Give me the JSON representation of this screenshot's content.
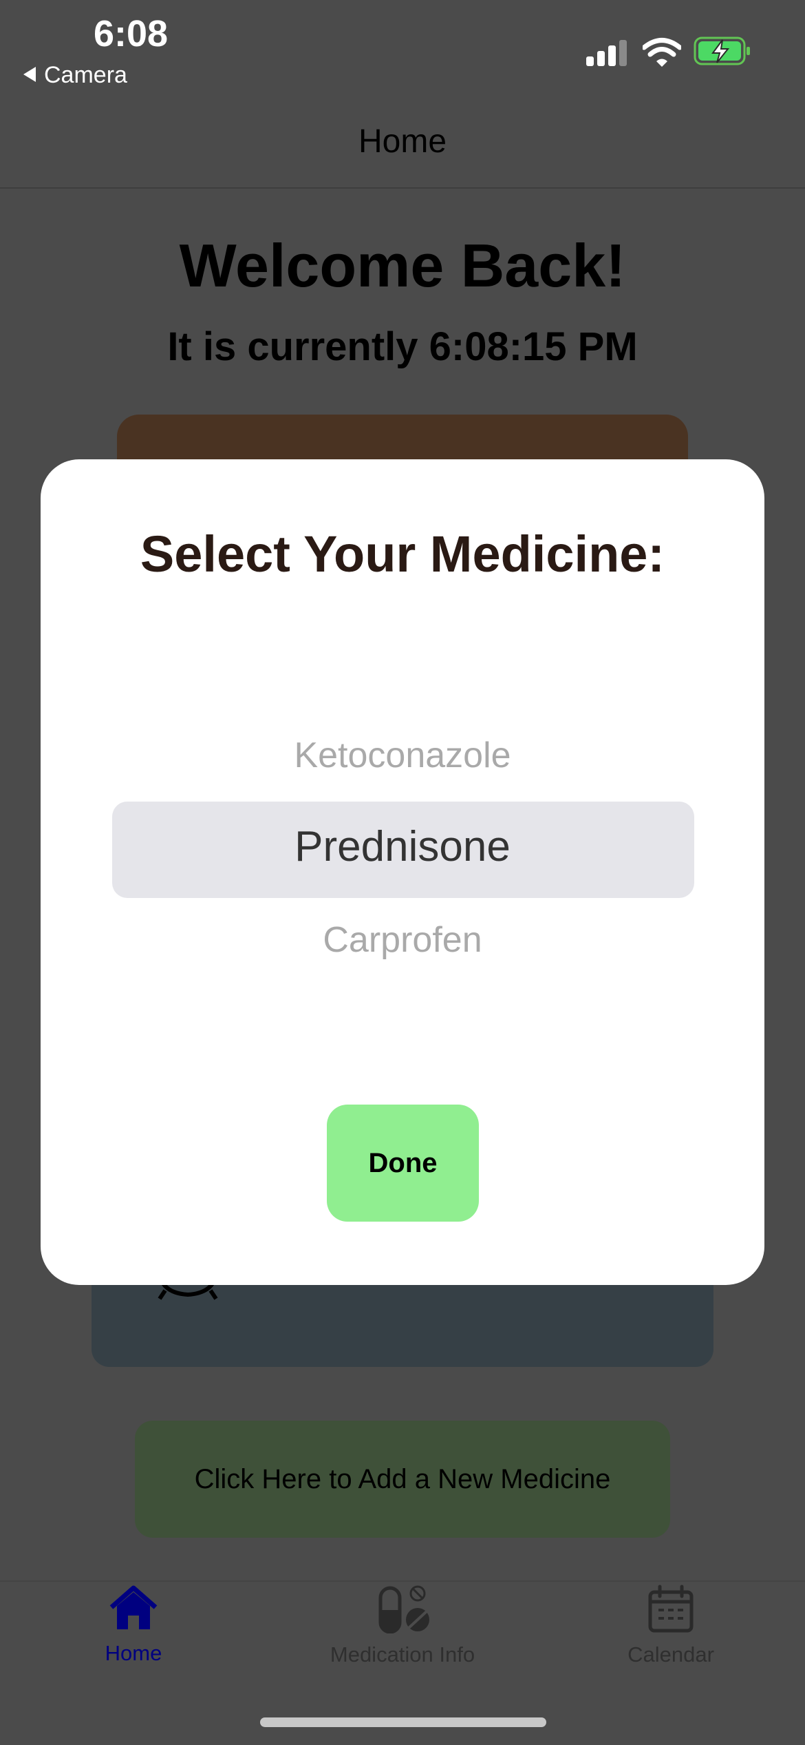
{
  "status_bar": {
    "time": "6:08",
    "back_label": "Camera"
  },
  "nav": {
    "title": "Home"
  },
  "main": {
    "welcome": "Welcome Back!",
    "clock": "It is currently 6:08:15 PM",
    "add_medicine_label": "Click Here to Add a New Medicine"
  },
  "modal": {
    "title": "Select Your Medicine:",
    "options": [
      "Ketoconazole",
      "Prednisone",
      "Carprofen"
    ],
    "selected_index": 1,
    "done_label": "Done"
  },
  "tabs": [
    {
      "label": "Home",
      "icon": "house-icon",
      "active": true
    },
    {
      "label": "Medication Info",
      "icon": "pills-icon",
      "active": false
    },
    {
      "label": "Calendar",
      "icon": "calendar-icon",
      "active": false
    }
  ],
  "colors": {
    "overlay_bg": "#4b4b4b",
    "done_button": "#90ee90",
    "active_tab": "#000080",
    "inactive_tab": "#2f2f2f",
    "picker_highlight": "#e5e5ea"
  }
}
